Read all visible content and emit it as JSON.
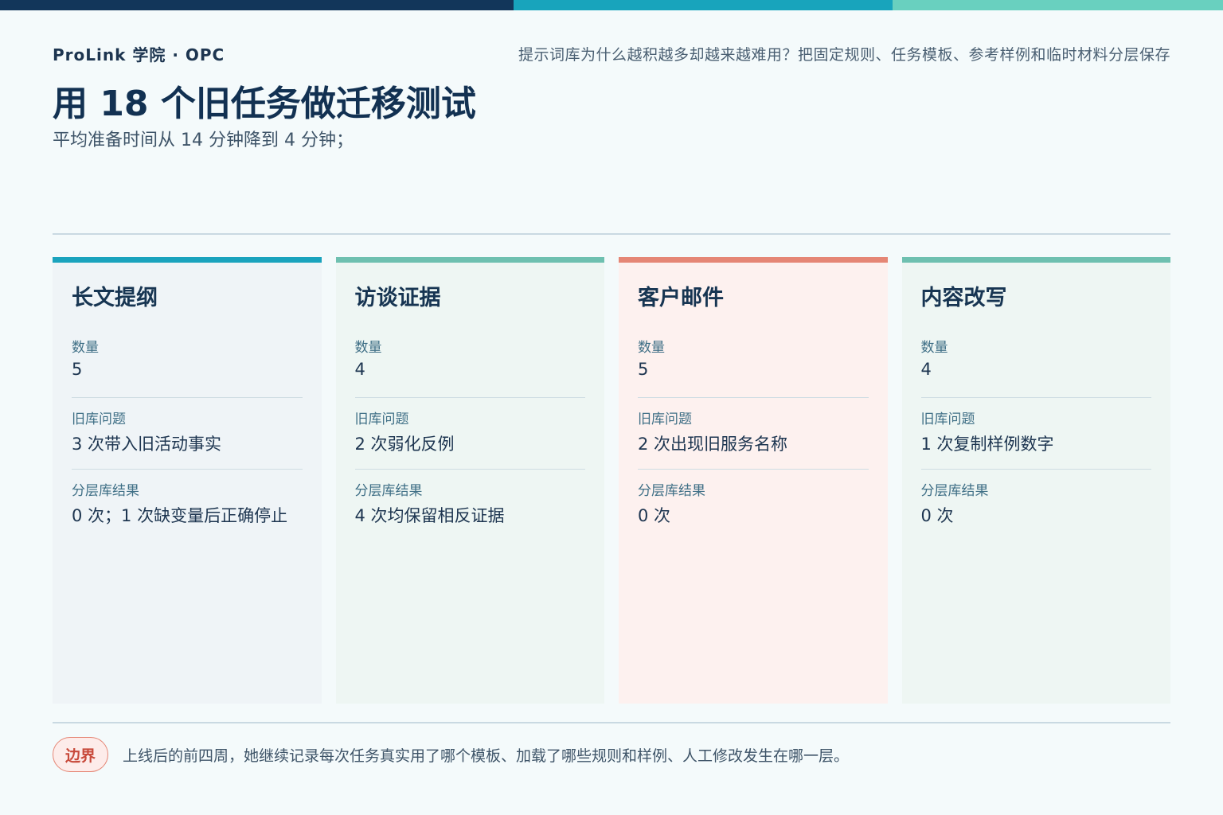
{
  "header": {
    "brand": "ProLink 学院 · OPC",
    "tagline": "提示词库为什么越积越多却越来越难用？把固定规则、任务模板、参考样例和临时材料分层保存",
    "title": "用 18 个旧任务做迁移测试",
    "subtitle": "平均准备时间从 14 分钟降到 4 分钟；"
  },
  "cards": [
    {
      "title": "长文提纲",
      "fields": [
        {
          "label": "数量",
          "value": "5"
        },
        {
          "label": "旧库问题",
          "value": "3 次带入旧活动事实"
        },
        {
          "label": "分层库结果",
          "value": "0 次；1 次缺变量后正确停止"
        }
      ]
    },
    {
      "title": "访谈证据",
      "fields": [
        {
          "label": "数量",
          "value": "4"
        },
        {
          "label": "旧库问题",
          "value": "2 次弱化反例"
        },
        {
          "label": "分层库结果",
          "value": "4 次均保留相反证据"
        }
      ]
    },
    {
      "title": "客户邮件",
      "fields": [
        {
          "label": "数量",
          "value": "5"
        },
        {
          "label": "旧库问题",
          "value": "2 次出现旧服务名称"
        },
        {
          "label": "分层库结果",
          "value": "0 次"
        }
      ]
    },
    {
      "title": "内容改写",
      "fields": [
        {
          "label": "数量",
          "value": "4"
        },
        {
          "label": "旧库问题",
          "value": "1 次复制样例数字"
        },
        {
          "label": "分层库结果",
          "value": "0 次"
        }
      ]
    }
  ],
  "footer": {
    "badge": "边界",
    "text": "上线后的前四周，她继续记录每次任务真实用了哪个模板、加载了哪些规则和样例、人工修改发生在哪一层。"
  },
  "colors": {
    "navy": "#12365a",
    "teal": "#18a4bc",
    "mint": "#69d0bf",
    "coral": "#e58675"
  }
}
